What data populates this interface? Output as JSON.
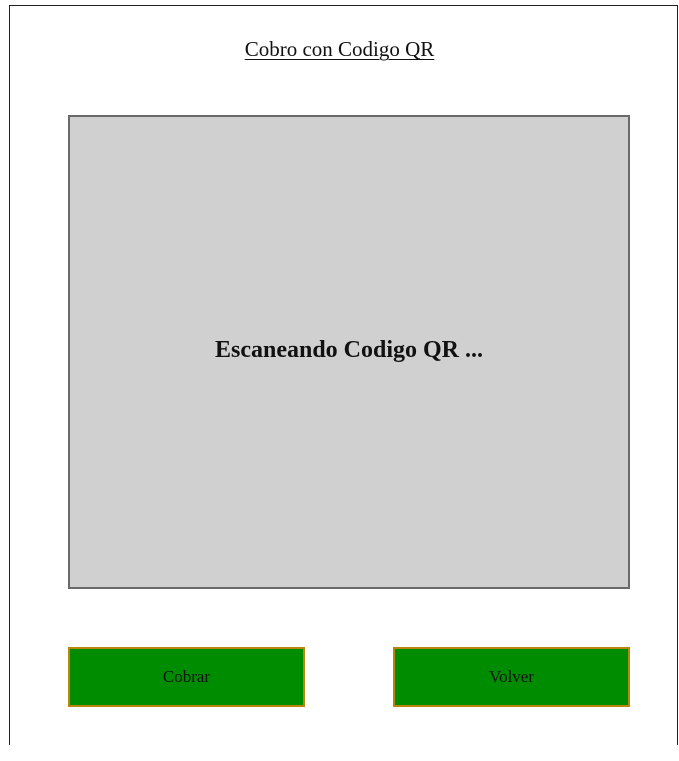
{
  "header": {
    "title": "Cobro con Codigo QR"
  },
  "scanner": {
    "status_text": "Escaneando Codigo QR ..."
  },
  "actions": {
    "cobrar_label": "Cobrar",
    "volver_label": "Volver"
  },
  "colors": {
    "button_bg": "#008c00",
    "button_border": "#b8860b",
    "scanner_bg": "#d0d0d0",
    "scanner_border": "#6a6a6a"
  }
}
